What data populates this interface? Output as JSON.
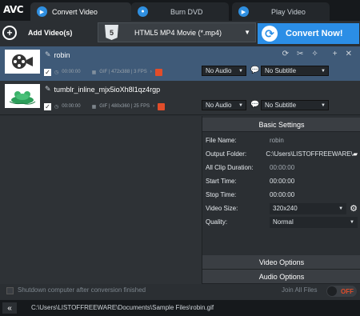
{
  "app": {
    "logo": "AVC"
  },
  "tabs": [
    {
      "label": "Convert Video",
      "active": true
    },
    {
      "label": "Burn DVD",
      "active": false
    },
    {
      "label": "Play Video",
      "active": false
    }
  ],
  "toolbar": {
    "add_label": "Add Video(s)",
    "format_badge": "5",
    "format_value": "HTML5 MP4 Movie (*.mp4)",
    "convert_label": "Convert Now!"
  },
  "files": [
    {
      "name": "robin",
      "duration": "00:00:00",
      "info": "GIF | 472x388 | 3 FPS",
      "audio": "No Audio",
      "subtitle": "No Subtitle",
      "checked": true,
      "selected": true
    },
    {
      "name": "tumblr_inline_mjx5ioXh8l1qz4rgp",
      "duration": "00:00:00",
      "info": "GIF | 480x360 | 25 FPS",
      "audio": "No Audio",
      "subtitle": "No Subtitle",
      "checked": true,
      "selected": false
    }
  ],
  "settings": {
    "header": "Basic Settings",
    "rows": [
      {
        "label": "File Name:",
        "value": "robin"
      },
      {
        "label": "Output Folder:",
        "value": "C:\\Users\\LISTOFFREEWARE\\"
      },
      {
        "label": "All Clip Duration:",
        "value": "00:00:00"
      },
      {
        "label": "Start Time:",
        "value": "00:00:00"
      },
      {
        "label": "Stop Time:",
        "value": "00:00:00"
      },
      {
        "label": "Video Size:",
        "value": "320x240"
      },
      {
        "label": "Quality:",
        "value": "Normal"
      }
    ],
    "video_options": "Video Options",
    "audio_options": "Audio Options"
  },
  "footer": {
    "shutdown_label": "Shutdown computer after conversion finished",
    "join_label": "Join All Files",
    "toggle_label": "OFF",
    "collapse_icon": "«",
    "path": "C:\\Users\\LISTOFFREEWARE\\Documents\\Sample Files\\robin.gif"
  },
  "colors": {
    "accent": "#2b8ee6",
    "selected_row": "#3f5a78",
    "html5": "#e14d2a"
  }
}
